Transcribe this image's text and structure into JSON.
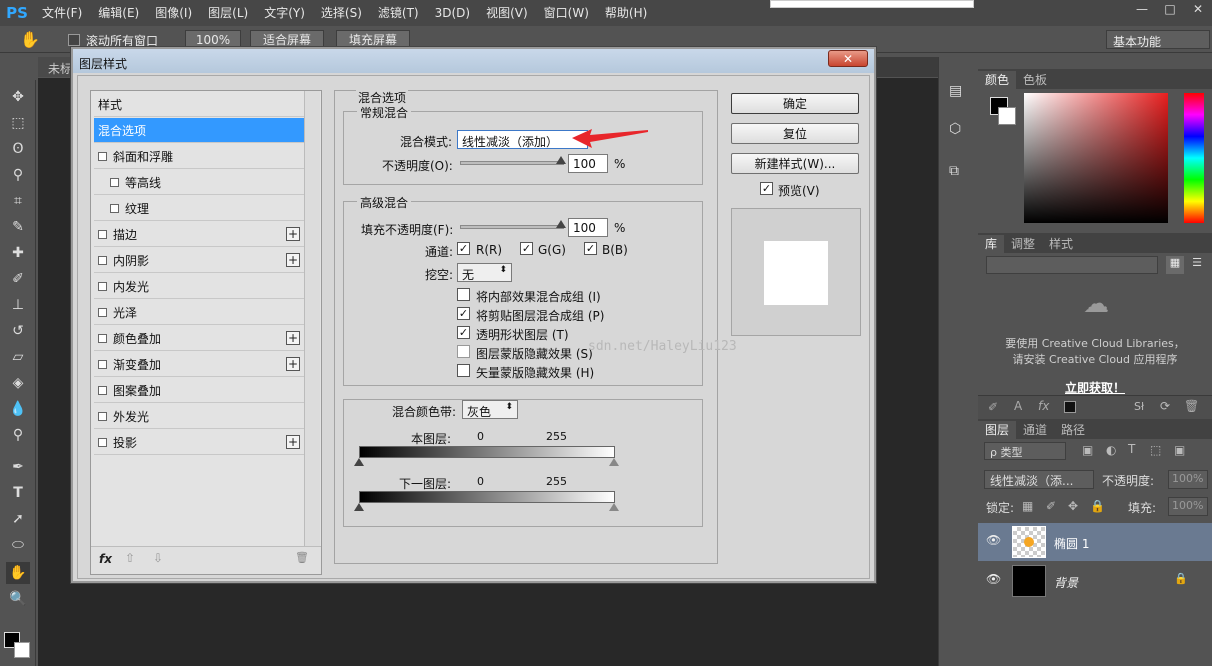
{
  "menubar": {
    "logo": "PS",
    "items": [
      "文件(F)",
      "编辑(E)",
      "图像(I)",
      "图层(L)",
      "文字(Y)",
      "选择(S)",
      "滤镜(T)",
      "3D(D)",
      "视图(V)",
      "窗口(W)",
      "帮助(H)"
    ]
  },
  "window_controls": {
    "minimize": "—",
    "maximize": "□",
    "close": "✕"
  },
  "options_bar": {
    "scroll_all_label": "滚动所有窗口",
    "zoom_100": "100%",
    "fit_screen": "适合屏幕",
    "fill_screen": "填充屏幕",
    "workspace": "基本功能"
  },
  "doc_tab": "未标",
  "dialog": {
    "title": "图层样式",
    "close": "✕",
    "style_list": {
      "items": [
        {
          "label": "样式",
          "checkbox": false,
          "plus": false,
          "selected": false
        },
        {
          "label": "混合选项",
          "checkbox": false,
          "plus": false,
          "selected": true
        },
        {
          "label": "斜面和浮雕",
          "checkbox": true,
          "plus": false,
          "selected": false
        },
        {
          "label": "等高线",
          "checkbox": true,
          "plus": false,
          "selected": false
        },
        {
          "label": "纹理",
          "checkbox": true,
          "plus": false,
          "selected": false
        },
        {
          "label": "描边",
          "checkbox": true,
          "plus": true,
          "selected": false
        },
        {
          "label": "内阴影",
          "checkbox": true,
          "plus": true,
          "selected": false
        },
        {
          "label": "内发光",
          "checkbox": true,
          "plus": false,
          "selected": false
        },
        {
          "label": "光泽",
          "checkbox": true,
          "plus": false,
          "selected": false
        },
        {
          "label": "颜色叠加",
          "checkbox": true,
          "plus": true,
          "selected": false
        },
        {
          "label": "渐变叠加",
          "checkbox": true,
          "plus": true,
          "selected": false
        },
        {
          "label": "图案叠加",
          "checkbox": true,
          "plus": false,
          "selected": false
        },
        {
          "label": "外发光",
          "checkbox": true,
          "plus": false,
          "selected": false
        },
        {
          "label": "投影",
          "checkbox": true,
          "plus": true,
          "selected": false
        }
      ],
      "footer_fx": "fx",
      "footer_up": "⇧",
      "footer_down": "⇩",
      "footer_trash": "🗑"
    },
    "blend": {
      "section_title": "混合选项",
      "general_title": "常规混合",
      "mode_label": "混合模式:",
      "mode_value": "线性减淡（添加）",
      "opacity_label": "不透明度(O):",
      "opacity_value": "100",
      "percent": "%",
      "advanced_title": "高级混合",
      "fill_opacity_label": "填充不透明度(F):",
      "fill_opacity_value": "100",
      "channels_label": "通道:",
      "channel_r": "R(R)",
      "channel_g": "G(G)",
      "channel_b": "B(B)",
      "knockout_label": "挖空:",
      "knockout_value": "无",
      "opt1": "将内部效果混合成组 (I)",
      "opt2": "将剪贴图层混合成组 (P)",
      "opt3": "透明形状图层 (T)",
      "opt4": "图层蒙版隐藏效果 (S)",
      "opt5": "矢量蒙版隐藏效果 (H)",
      "opt1_checked": false,
      "opt2_checked": true,
      "opt3_checked": true,
      "opt4_checked": false,
      "opt5_checked": false,
      "blend_if_label": "混合颜色带:",
      "blend_if_value": "灰色",
      "this_layer": "本图层:",
      "underlying_layer": "下一图层:",
      "range_min": "0",
      "range_max": "255",
      "watermark": "sdn.net/HaleyLiu123"
    },
    "buttons": {
      "ok": "确定",
      "reset": "复位",
      "new_style": "新建样式(W)...",
      "preview": "预览(V)"
    },
    "colors": {
      "selected": "#3399ff",
      "arrow": "#e8262b"
    }
  },
  "color_panel": {
    "tabs": [
      "颜色",
      "色板"
    ]
  },
  "library_panel": {
    "tabs": [
      "库",
      "调整",
      "样式"
    ],
    "message_line1": "要使用 Creative Cloud Libraries，",
    "message_line2": "请安装 Creative Cloud 应用程序",
    "link": "立即获取！"
  },
  "layers_panel": {
    "tabs": [
      "图层",
      "通道",
      "路径"
    ],
    "filter": "ρ 类型",
    "blend_mode": "线性减淡（添...",
    "opacity_label": "不透明度:",
    "opacity_value": "100%",
    "lock_label": "锁定:",
    "fill_label": "填充:",
    "fill_value": "100%",
    "layers": [
      {
        "name": "椭圆 1",
        "selected": true
      },
      {
        "name": "背景",
        "selected": false
      }
    ]
  }
}
